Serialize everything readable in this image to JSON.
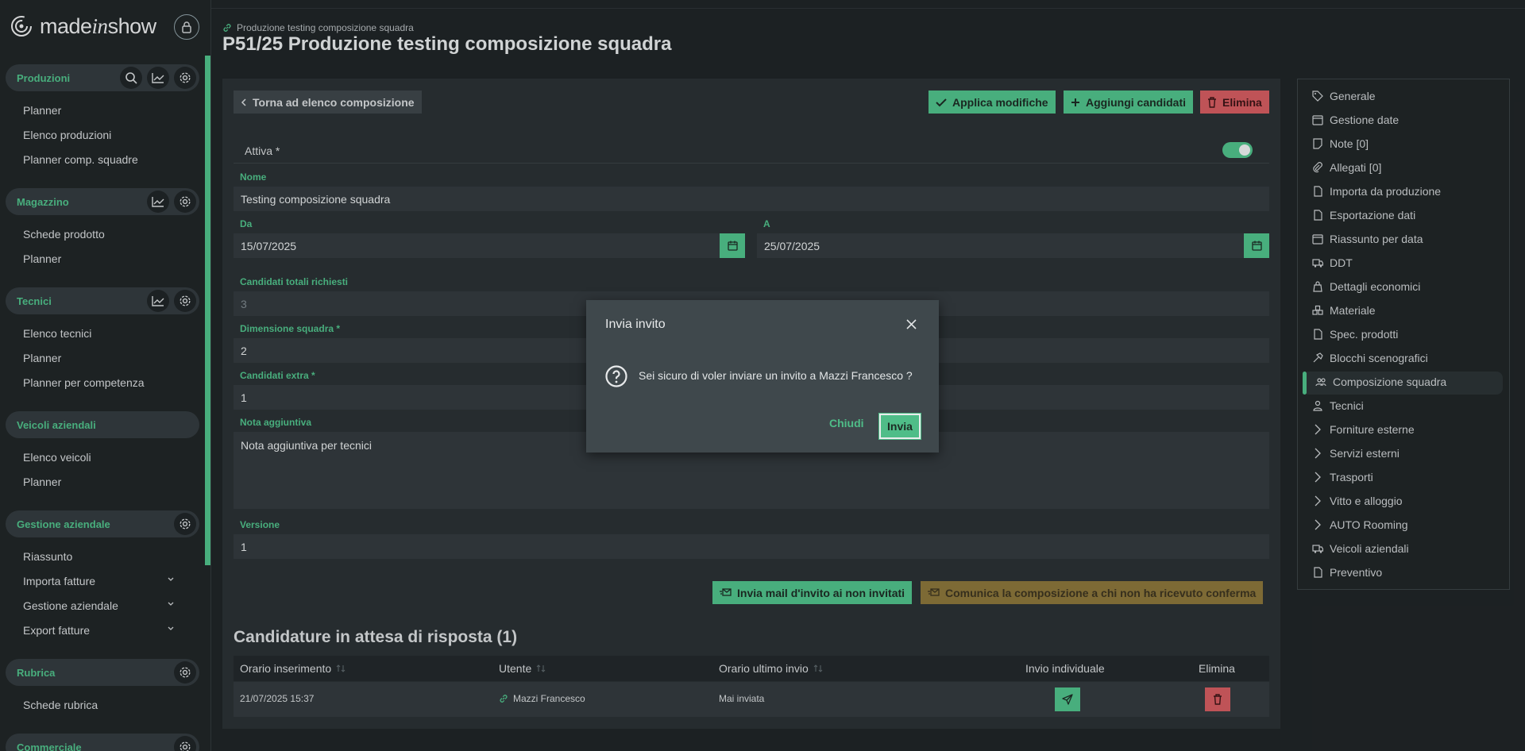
{
  "app": {
    "logo_main": "made",
    "logo_italic": "in",
    "logo_end": "show"
  },
  "sidebar": {
    "sections": [
      {
        "title": "Produzioni",
        "items": [
          "Planner",
          "Elenco produzioni",
          "Planner comp. squadre"
        ]
      },
      {
        "title": "Magazzino",
        "items": [
          "Schede prodotto",
          "Planner"
        ]
      },
      {
        "title": "Tecnici",
        "items": [
          "Elenco tecnici",
          "Planner",
          "Planner per competenza"
        ]
      },
      {
        "title": "Veicoli aziendali",
        "items": [
          "Elenco veicoli",
          "Planner"
        ]
      },
      {
        "title": "Gestione aziendale",
        "items": [
          "Riassunto",
          "Importa fatture",
          "Gestione aziendale",
          "Export fatture"
        ]
      },
      {
        "title": "Rubrica",
        "items": [
          "Schede rubrica"
        ]
      },
      {
        "title": "Commerciale",
        "items": []
      }
    ]
  },
  "header": {
    "breadcrumb": "Produzione testing composizione squadra",
    "title": "P51/25 Produzione testing composizione squadra"
  },
  "toolbar": {
    "back": "Torna ad elenco composizione",
    "apply": "Applica modifiche",
    "add": "Aggiungi candidati",
    "delete": "Elimina"
  },
  "form": {
    "attiva_label": "Attiva *",
    "nome_label": "Nome",
    "nome_value": "Testing composizione squadra",
    "da_label": "Da",
    "da_value": "15/07/2025",
    "a_label": "A",
    "a_value": "25/07/2025",
    "candidati_totali_label": "Candidati totali richiesti",
    "candidati_totali_value": "3",
    "dimensione_label": "Dimensione squadra *",
    "dimensione_value": "2",
    "extra_label": "Candidati extra *",
    "extra_value": "1",
    "nota_label": "Nota aggiuntiva",
    "nota_value": "Nota aggiuntiva per tecnici",
    "versione_label": "Versione",
    "versione_value": "1"
  },
  "actions": {
    "invia_mail": "Invia mail d'invito ai non invitati",
    "comunica": "Comunica la composizione a chi non ha ricevuto conferma"
  },
  "table": {
    "title": "Candidature in attesa di risposta (1)",
    "columns": [
      "Orario inserimento",
      "Utente",
      "Orario ultimo invio",
      "Invio individuale",
      "Elimina"
    ],
    "rows": [
      {
        "inserimento": "21/07/2025 15:37",
        "utente": "Mazzi Francesco",
        "ultimo_invio": "Mai inviata"
      }
    ]
  },
  "rightnav": {
    "items": [
      "Generale",
      "Gestione date",
      "Note [0]",
      "Allegati [0]",
      "Importa da produzione",
      "Esportazione dati",
      "Riassunto per data",
      "DDT",
      "Dettagli economici",
      "Materiale",
      "Spec. prodotti",
      "Blocchi scenografici",
      "Composizione squadra",
      "Tecnici",
      "Forniture esterne",
      "Servizi esterni",
      "Trasporti",
      "Vitto e alloggio",
      "AUTO Rooming",
      "Veicoli aziendali",
      "Preventivo"
    ],
    "active": "Composizione squadra"
  },
  "modal": {
    "title": "Invia invito",
    "message": "Sei sicuro di voler inviare un invito a Mazzi Francesco ?",
    "cancel": "Chiudi",
    "confirm": "Invia"
  },
  "colors": {
    "accent": "#4fbd88",
    "danger": "#d05b5f",
    "warning": "#88733a",
    "background": "#1f2426"
  }
}
